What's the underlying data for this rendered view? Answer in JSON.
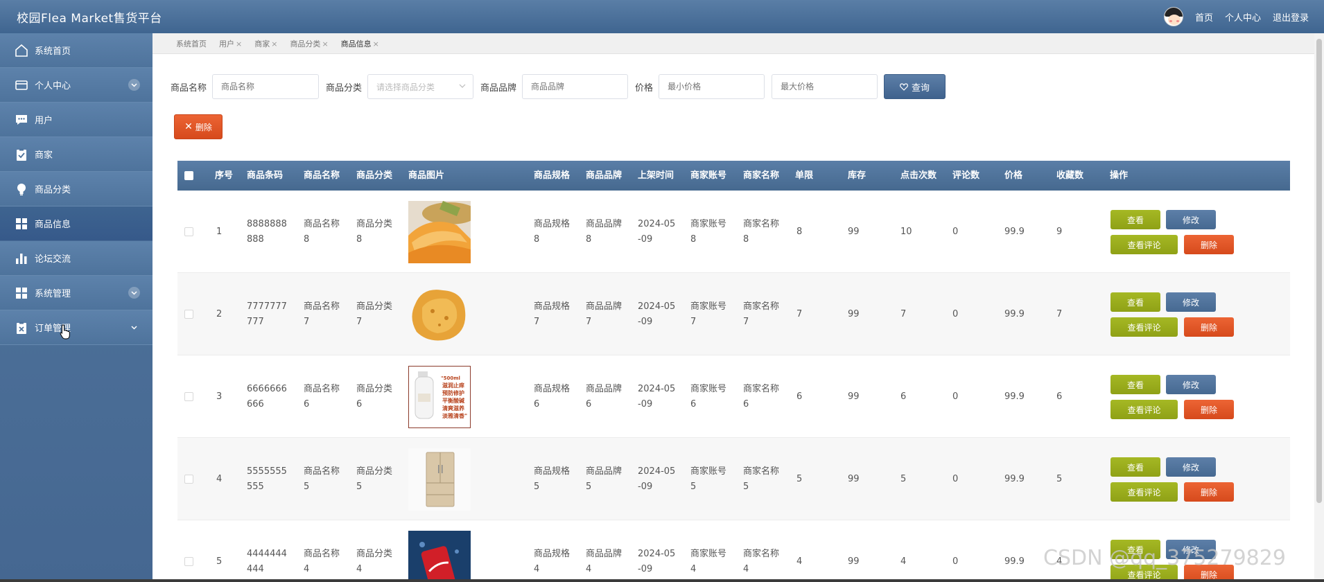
{
  "header": {
    "app_title": "校园Flea Market售货平台",
    "links": [
      "首页",
      "个人中心",
      "退出登录"
    ]
  },
  "sidebar": {
    "items": [
      {
        "label": "系统首页",
        "icon": "home-icon"
      },
      {
        "label": "个人中心",
        "icon": "card-icon",
        "expandable": true
      },
      {
        "label": "用户",
        "icon": "chat-icon"
      },
      {
        "label": "商家",
        "icon": "clipboard-check-icon"
      },
      {
        "label": "商品分类",
        "icon": "bulb-icon"
      },
      {
        "label": "商品信息",
        "icon": "grid-icon",
        "active": true
      },
      {
        "label": "论坛交流",
        "icon": "bar-chart-icon"
      },
      {
        "label": "系统管理",
        "icon": "grid-icon",
        "expandable": true
      },
      {
        "label": "订单管理",
        "icon": "clipboard-x-icon",
        "expandable": true
      }
    ]
  },
  "tabs": [
    {
      "label": "系统首页",
      "closable": false
    },
    {
      "label": "用户",
      "closable": true
    },
    {
      "label": "商家",
      "closable": true
    },
    {
      "label": "商品分类",
      "closable": true
    },
    {
      "label": "商品信息",
      "closable": true,
      "active": true
    }
  ],
  "filters": {
    "name_label": "商品名称",
    "name_placeholder": "商品名称",
    "category_label": "商品分类",
    "category_placeholder": "请选择商品分类",
    "brand_label": "商品品牌",
    "brand_placeholder": "商品品牌",
    "price_label": "价格",
    "min_placeholder": "最小价格",
    "max_placeholder": "最大价格",
    "query_label": "查询"
  },
  "delete_label": "删除",
  "table": {
    "columns": [
      "序号",
      "商品条码",
      "商品名称",
      "商品分类",
      "商品图片",
      "商品规格",
      "商品品牌",
      "上架时间",
      "商家账号",
      "商家名称",
      "单限",
      "库存",
      "点击次数",
      "评论数",
      "价格",
      "收藏数",
      "操作"
    ],
    "actions": {
      "view": "查看",
      "edit": "修改",
      "review": "查看评论",
      "delete": "删除"
    },
    "rows": [
      {
        "no": "1",
        "barcode": "8888888888",
        "name": "商品名称8",
        "category": "商品分类8",
        "image": "melon",
        "spec": "商品规格8",
        "brand": "商品品牌8",
        "date": "2024-05-09",
        "account": "商家账号8",
        "merchant": "商家名称8",
        "limit": "8",
        "stock": "99",
        "clicks": "10",
        "comments": "0",
        "price": "99.9",
        "favorites": "9"
      },
      {
        "no": "2",
        "barcode": "7777777777",
        "name": "商品名称7",
        "category": "商品分类7",
        "image": "chicken",
        "spec": "商品规格7",
        "brand": "商品品牌7",
        "date": "2024-05-09",
        "account": "商家账号7",
        "merchant": "商家名称7",
        "limit": "7",
        "stock": "99",
        "clicks": "7",
        "comments": "0",
        "price": "99.9",
        "favorites": "7"
      },
      {
        "no": "3",
        "barcode": "6666666666",
        "name": "商品名称6",
        "category": "商品分类6",
        "image": "lotion",
        "spec": "商品规格6",
        "brand": "商品品牌6",
        "date": "2024-05-09",
        "account": "商家账号6",
        "merchant": "商家名称6",
        "limit": "6",
        "stock": "99",
        "clicks": "6",
        "comments": "0",
        "price": "99.9",
        "favorites": "6"
      },
      {
        "no": "4",
        "barcode": "5555555555",
        "name": "商品名称5",
        "category": "商品分类5",
        "image": "fridge",
        "spec": "商品规格5",
        "brand": "商品品牌5",
        "date": "2024-05-09",
        "account": "商家账号5",
        "merchant": "商家名称5",
        "limit": "5",
        "stock": "99",
        "clicks": "5",
        "comments": "0",
        "price": "99.9",
        "favorites": "5"
      },
      {
        "no": "5",
        "barcode": "4444444444",
        "name": "商品名称4",
        "category": "商品分类4",
        "image": "cola",
        "spec": "商品规格4",
        "brand": "商品品牌4",
        "date": "2024-05-09",
        "account": "商家账号4",
        "merchant": "商家名称4",
        "limit": "4",
        "stock": "99",
        "clicks": "4",
        "comments": "0",
        "price": "99.9",
        "favorites": "4"
      }
    ]
  },
  "lotion_text": [
    "\"500ml",
    "滋润止痒",
    "预防修护",
    "平衡酸碱",
    "清爽滋养",
    "淡雅清香\""
  ],
  "watermark": "CSDN @qq_375279829",
  "colors": {
    "primary": "#4a6d96",
    "olive": "#9aad1e",
    "danger": "#e0562a"
  }
}
